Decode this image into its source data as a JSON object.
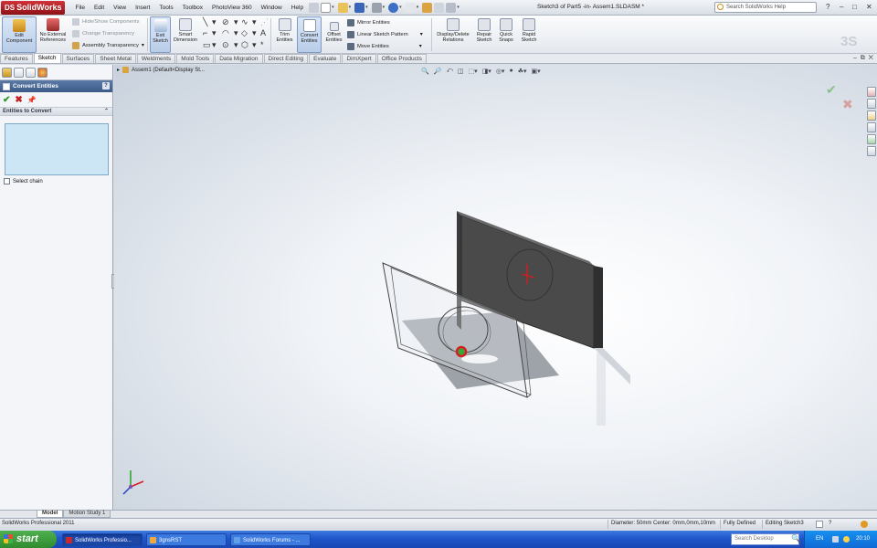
{
  "app": {
    "logo_text": "SolidWorks",
    "logo_brand": "DS",
    "doc_title": "Sketch3 of Part5 -in- Assem1.SLDASM *",
    "help_search_placeholder": "Search SolidWorks Help"
  },
  "menus": [
    "File",
    "Edit",
    "View",
    "Insert",
    "Tools",
    "Toolbox",
    "PhotoView 360",
    "Window",
    "Help"
  ],
  "window_controls": [
    "?",
    "–",
    "□",
    "✕"
  ],
  "command_manager": {
    "edit_component": "Edit Component",
    "no_external_refs": "No External References",
    "hide_show_components": "Hide/Show Components",
    "change_transparency": "Change Transparency",
    "assembly_transparency": "Assembly Transparency",
    "exit_sketch": "Exit Sketch",
    "smart_dimension": "Smart Dimension",
    "trim_entities": "Trim Entities",
    "convert_entities": "Convert Entities",
    "offset_entities": "Offset Entities",
    "mirror_entities": "Mirror Entities",
    "linear_sketch_pattern": "Linear Sketch Pattern",
    "move_entities": "Move Entities",
    "display_delete_relations": "Display/Delete Relations",
    "repair_sketch": "Repair Sketch",
    "quick_snaps": "Quick Snaps",
    "rapid_sketch": "Rapid Sketch"
  },
  "tabs": [
    "Features",
    "Sketch",
    "Surfaces",
    "Sheet Metal",
    "Weldments",
    "Mold Tools",
    "Data Migration",
    "Direct Editing",
    "Evaluate",
    "DimXpert",
    "Office Products"
  ],
  "active_tab": "Sketch",
  "property_manager": {
    "title": "Convert Entities",
    "help": "?",
    "group_title": "Entities to Convert",
    "select_chain_label": "Select chain"
  },
  "graphics": {
    "tree_flyout": "Assem1  (Default<Display St...",
    "view_toolbar_icons": [
      "zoom-to-fit-icon",
      "zoom-area-icon",
      "previous-view-icon",
      "section-view-icon",
      "view-orientation-icon",
      "display-style-icon",
      "hide-show-items-icon",
      "edit-appearance-icon",
      "apply-scene-icon",
      "view-settings-icon"
    ]
  },
  "model_tabs": [
    "Model",
    "Motion Study 1"
  ],
  "active_model_tab": "Model",
  "status": {
    "product": "SolidWorks Professional 2011",
    "geometry": "Diameter: 50mm  Center: 0mm,0mm,10mm",
    "definition": "Fully Defined",
    "editing": "Editing Sketch3",
    "help_btn": "?"
  },
  "taskbar": {
    "start": "start",
    "tasks": [
      "SolidWorks Professio...",
      "3gnsRST",
      "SolidWorks Forums - ..."
    ],
    "search_placeholder": "Search Desktop",
    "lang": "EN",
    "clock": "20:10"
  },
  "colors": {
    "accent": "#3c5a88",
    "entity_box": "#cde6f5",
    "ok": "#2b9a2b",
    "cancel": "#c21f1f",
    "taskbar": "#1f55c9"
  }
}
